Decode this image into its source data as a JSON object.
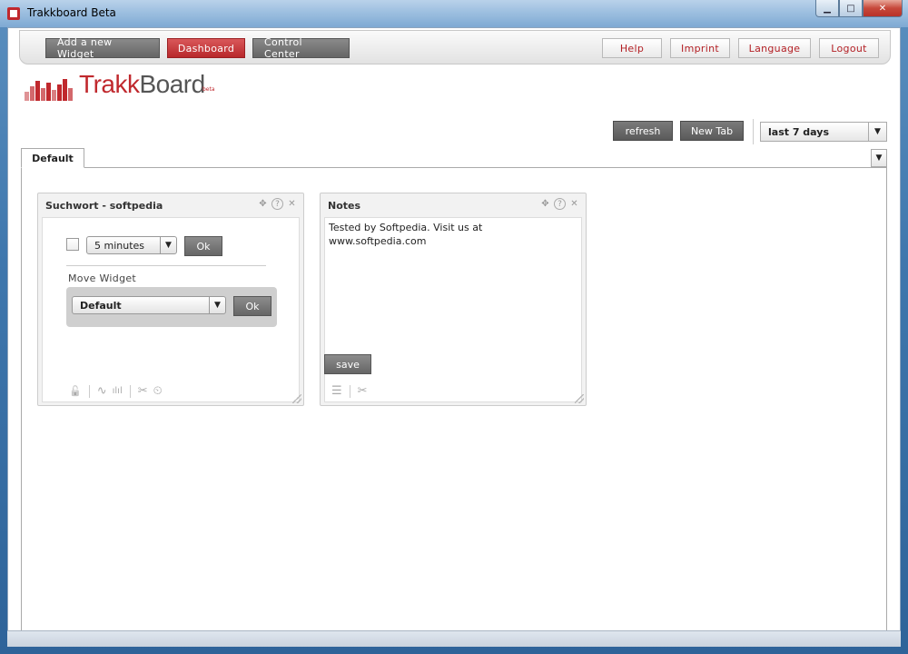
{
  "window": {
    "title": "Trakkboard Beta",
    "min_glyph": "▁",
    "max_glyph": "□",
    "close_glyph": "✕"
  },
  "nav": {
    "add_widget": "Add a new Widget",
    "dashboard": "Dashboard",
    "control_center": "Control Center",
    "help": "Help",
    "imprint": "Imprint",
    "language": "Language",
    "logout": "Logout"
  },
  "logo": {
    "part1": "Trakk",
    "part2": "Board",
    "beta": "beta"
  },
  "toolbar": {
    "refresh": "refresh",
    "new_tab": "New Tab",
    "range_value": "last 7 days"
  },
  "tabs": [
    {
      "label": "Default",
      "active": true
    }
  ],
  "widgets": {
    "search": {
      "title": "Suchwort - softpedia",
      "interval": "5 minutes",
      "ok1": "Ok",
      "move_label": "Move Widget",
      "move_target": "Default",
      "ok2": "Ok"
    },
    "notes": {
      "title": "Notes",
      "text_line1": "Tested by Softpedia. Visit us at",
      "text_line2": "www.softpedia.com",
      "save": "save"
    }
  },
  "icons": {
    "move": "✥",
    "help": "?",
    "close": "✕",
    "caret": "▼",
    "lock": "🔓",
    "line_chart": "∿",
    "bar_chart": "ılıl",
    "settings": "✂",
    "timer": "⏲",
    "list": "☰"
  },
  "colors": {
    "accent": "#c0282d",
    "button_dark": "#666666",
    "panel_gray": "#cfcfcf"
  }
}
